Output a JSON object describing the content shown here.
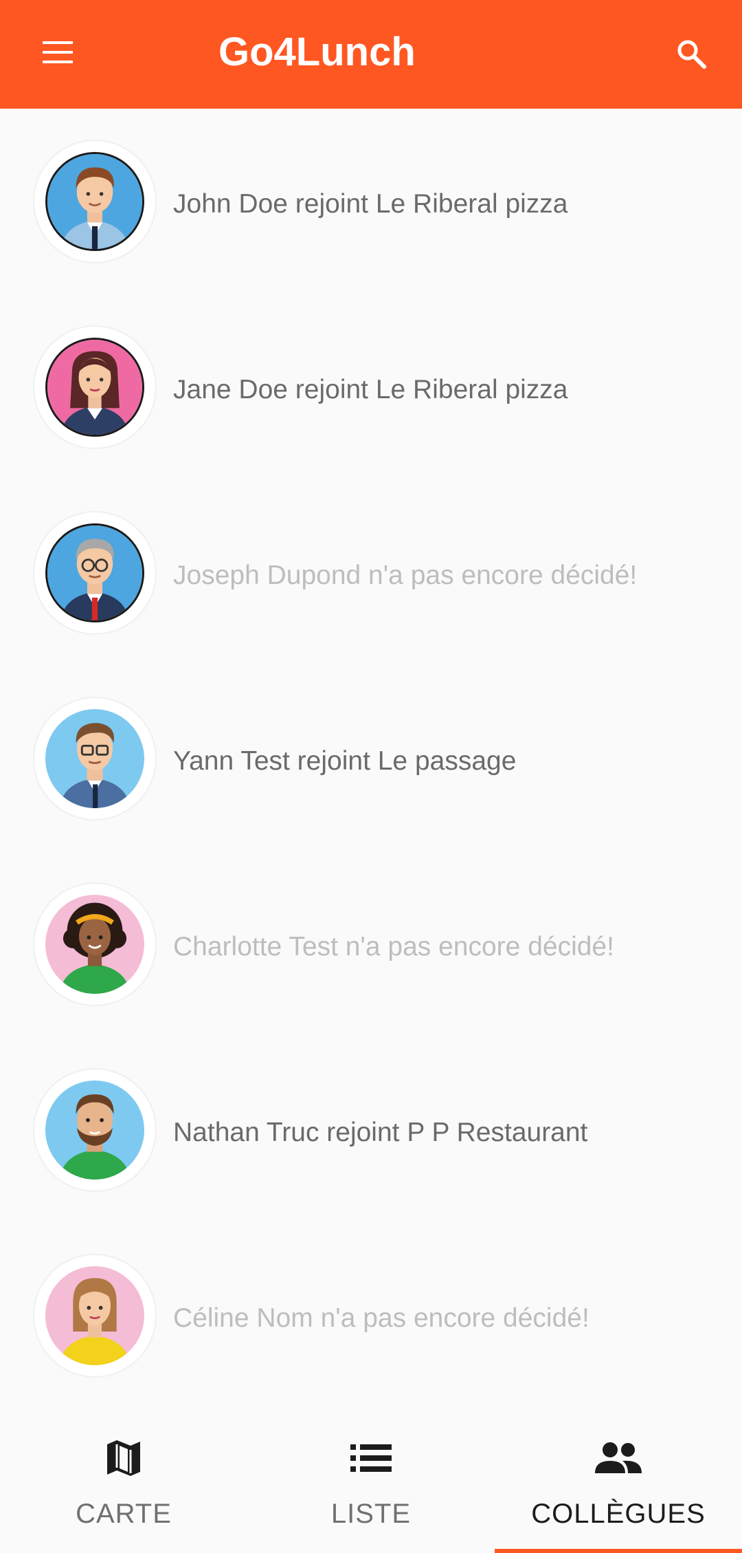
{
  "app_bar": {
    "title": "Go4Lunch",
    "background_color": "#ff5722",
    "menu_icon": "menu-icon",
    "search_icon": "search-icon"
  },
  "workmates": [
    {
      "text": "John Doe rejoint Le Riberal pizza",
      "status": "joined",
      "avatar": "man-brown-hair-suit",
      "avatar_bg": "#4da6df"
    },
    {
      "text": "Jane Doe rejoint Le Riberal pizza",
      "status": "joined",
      "avatar": "woman-dark-hair-blazer",
      "avatar_bg": "#ef6aa3"
    },
    {
      "text": "Joseph Dupond n'a pas encore décidé!",
      "status": "undecided",
      "avatar": "older-man-glasses-suit",
      "avatar_bg": "#4da6df"
    },
    {
      "text": "Yann Test rejoint Le passage",
      "status": "joined",
      "avatar": "man-glasses-blue-suit",
      "avatar_bg": "#7ec9f0"
    },
    {
      "text": "Charlotte Test n'a pas encore décidé!",
      "status": "undecided",
      "avatar": "woman-curly-hair-green",
      "avatar_bg": "#f5bcd6"
    },
    {
      "text": "Nathan Truc rejoint P P Restaurant",
      "status": "joined",
      "avatar": "man-beard-green-shirt",
      "avatar_bg": "#7ec9f0"
    },
    {
      "text": "Céline Nom n'a pas encore décidé!",
      "status": "undecided",
      "avatar": "woman-bob-yellow-top",
      "avatar_bg": "#f5bcd6"
    }
  ],
  "bottom_nav": {
    "items": [
      {
        "label": "CARTE",
        "icon": "map-icon",
        "active": false
      },
      {
        "label": "LISTE",
        "icon": "list-icon",
        "active": false
      },
      {
        "label": "COLLÈGUES",
        "icon": "people-icon",
        "active": true
      }
    ],
    "accent_color": "#ff5722"
  }
}
